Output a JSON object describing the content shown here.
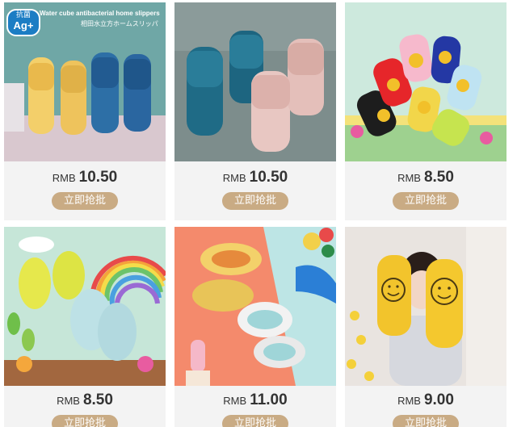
{
  "products": [
    {
      "currency": "RMB",
      "price": "10.50",
      "button": "立即抢批",
      "image": "yellow-blue-slippers",
      "badge_top": "抗菌",
      "badge_bottom": "Ag+",
      "banner_en": "Water cube antibacterial home slippers",
      "banner_jp": "相田水立方ホームスリッパ"
    },
    {
      "currency": "RMB",
      "price": "10.50",
      "button": "立即抢批",
      "image": "blue-pink-quilted-slippers"
    },
    {
      "currency": "RMB",
      "price": "8.50",
      "button": "立即抢批",
      "image": "duck-kids-slippers"
    },
    {
      "currency": "RMB",
      "price": "8.50",
      "button": "立即抢批",
      "image": "rainbow-kids-clogs"
    },
    {
      "currency": "RMB",
      "price": "11.00",
      "button": "立即抢批",
      "image": "camo-clogs"
    },
    {
      "currency": "RMB",
      "price": "9.00",
      "button": "立即抢批",
      "image": "smiley-face-slippers"
    }
  ],
  "colors": {
    "button_bg": "#c9ab84",
    "card_bg": "#f3f3f3",
    "price_text": "#333333"
  }
}
